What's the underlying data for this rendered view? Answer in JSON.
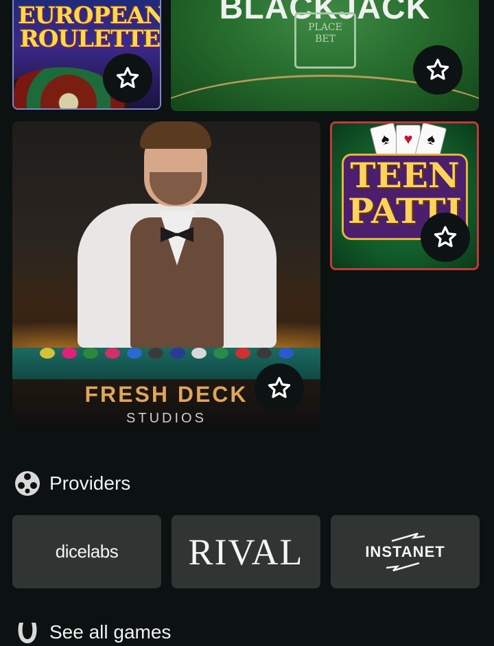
{
  "games": [
    {
      "id": "european-roulette",
      "title_line1": "EUROPEAN",
      "title_line2": "ROULETTE"
    },
    {
      "id": "blackjack",
      "title": "BLACKJACK",
      "box_label_1": "PLACE",
      "box_label_2": "BET"
    },
    {
      "id": "fresh-deck",
      "brand": "FRESH DECK",
      "sub": "STUDIOS"
    },
    {
      "id": "teen-patti",
      "title_line1": "TEEN",
      "title_line2": "PATTI"
    }
  ],
  "favorite_icon": "star-outline-icon",
  "providers_section": {
    "title": "Providers",
    "icon": "film-reel-icon"
  },
  "providers": [
    {
      "name": "dicelabs"
    },
    {
      "name": "RIVAL"
    },
    {
      "name": "INSTANET"
    }
  ],
  "see_all": {
    "label": "See all games",
    "icon": "horseshoe-icon"
  },
  "colors": {
    "background": "#0b1211",
    "card": "#303534",
    "text": "#f2f2f2"
  }
}
